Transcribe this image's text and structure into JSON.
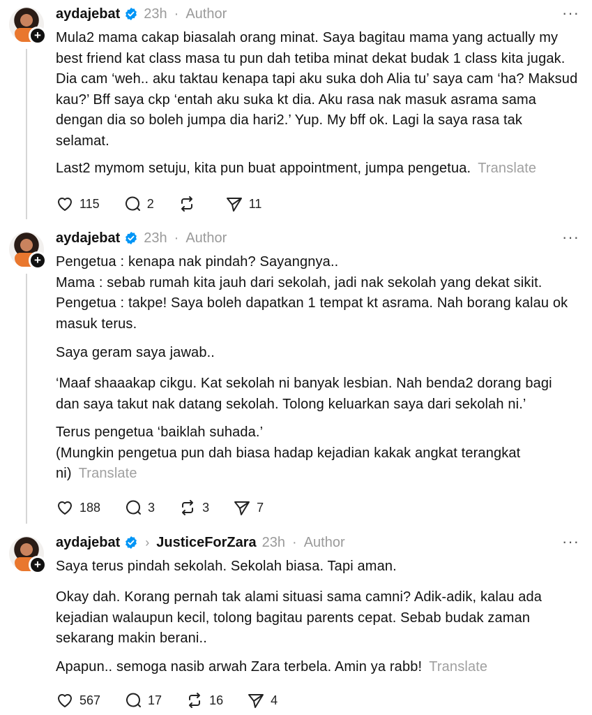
{
  "posts": [
    {
      "username": "aydajebat",
      "time": "23h",
      "separator": "·",
      "author_label": "Author",
      "more": "···",
      "paragraphs": [
        "Mula2 mama cakap biasalah orang minat. Saya bagitau mama yang actually my best friend kat class masa tu pun dah tetiba minat dekat budak 1 class kita jugak. Dia cam ‘weh.. aku taktau kenapa tapi aku suka doh Alia tu’ saya cam ‘ha? Maksud kau?’ Bff saya ckp ‘entah aku suka kt dia. Aku rasa nak masuk asrama sama dengan dia so boleh jumpa dia hari2.’ Yup. My bff ok. Lagi la saya rasa tak selamat.",
        "Last2 mymom setuju, kita pun buat appointment, jumpa pengetua."
      ],
      "translate": "Translate",
      "likes": "115",
      "replies": "2",
      "reposts": "",
      "shares": "11"
    },
    {
      "username": "aydajebat",
      "time": "23h",
      "separator": "·",
      "author_label": "Author",
      "more": "···",
      "paragraphs": [
        "Pengetua : kenapa nak pindah? Sayangnya..",
        "Mama : sebab rumah kita jauh dari sekolah, jadi nak sekolah yang dekat sikit.",
        "Pengetua : takpe! Saya boleh dapatkan 1 tempat kt asrama. Nah borang kalau ok masuk terus.",
        "Saya geram saya jawab..",
        "‘Maaf shaaakap cikgu. Kat sekolah ni banyak lesbian. Nah benda2 dorang bagi dan saya takut nak datang sekolah. Tolong keluarkan saya dari sekolah ni.’",
        "Terus pengetua ‘baiklah suhada.’",
        "(Mungkin pengetua pun dah biasa hadap kejadian kakak angkat terangkat ni)"
      ],
      "translate": "Translate",
      "likes": "188",
      "replies": "3",
      "reposts": "3",
      "shares": "7"
    },
    {
      "username": "aydajebat",
      "reply_to": "JusticeForZara",
      "time": "23h",
      "separator": "",
      "author_label": "Author",
      "more": "···",
      "paragraphs": [
        "Saya terus pindah sekolah. Sekolah biasa. Tapi aman.",
        "Okay dah. Korang pernah tak alami situasi sama camni? Adik-adik, kalau ada kejadian walaupun kecil, tolong bagitau parents cepat. Sebab budak zaman sekarang makin berani..",
        "Apapun.. semoga nasib arwah Zara terbela. Amin ya rabb!"
      ],
      "translate": "Translate",
      "likes": "567",
      "replies": "17",
      "reposts": "16",
      "shares": "4"
    }
  ],
  "colors": {
    "verified_blue": "#0095f6",
    "muted": "#9a9a9a",
    "avatar_accent": "#e9772e"
  }
}
